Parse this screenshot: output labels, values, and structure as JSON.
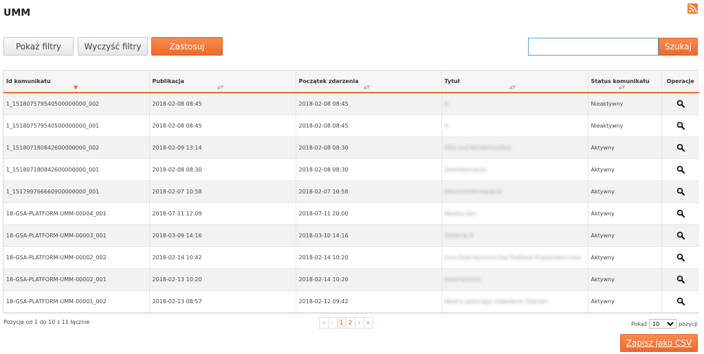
{
  "header": {
    "title": "UMM"
  },
  "toolbar": {
    "show_filters": "Pokaż filtry",
    "clear_filters": "Wyczyść filtry",
    "apply": "Zastosuj"
  },
  "search": {
    "value": "",
    "button": "Szukaj"
  },
  "table": {
    "columns": [
      "Id komunikatu",
      "Publikacja",
      "Początek zdarzenia",
      "Tytuł",
      "Status komunikatu",
      "Operacje"
    ],
    "rows": [
      {
        "id": "1_151807579540500000000_002",
        "published": "2018-02-08 08:45",
        "start": "2018-02-08 08:45",
        "title": "A",
        "status": "Nieaktywny"
      },
      {
        "id": "1_151807579540500000000_001",
        "published": "2018-02-08 08:45",
        "start": "2018-02-08 08:45",
        "title": "A",
        "status": "Nieaktywny"
      },
      {
        "id": "1_151807180842600000000_002",
        "published": "2018-02-09 13:14",
        "start": "2018-02-08 08:30",
        "title": "DEA und Nordatmosfera",
        "status": "Aktywny"
      },
      {
        "id": "1_151807180842600000000_001",
        "published": "2018-02-08 08:30",
        "start": "2018-02-08 08:30",
        "title": "Zawiadomienie",
        "status": "Aktywny"
      },
      {
        "id": "1_151799766660900000000_001",
        "published": "2018-02-07 10:58",
        "start": "2018-02-07 10:58",
        "title": "Ekonominformacje N",
        "status": "Aktywny"
      },
      {
        "id": "18-GSA-PLATFORM-UMM-00004_001",
        "published": "2018-07-11 12:09",
        "start": "2018-07-11 20:00",
        "title": "Awaria sieci",
        "status": "Aktywny"
      },
      {
        "id": "18-GSA-PLATFORM-UMM-00003_001",
        "published": "2018-03-09 14:16",
        "start": "2018-03-10 14:16",
        "title": "Ostatnie A",
        "status": "Aktywny"
      },
      {
        "id": "18-GSA-PLATFORM-UMM-00002_002",
        "published": "2018-02-14 10:42",
        "start": "2018-02-14 10:20",
        "title": "Inne Dział Kontrola Gaz Podlasie Przedsiebiorstwo",
        "status": "Aktywny"
      },
      {
        "id": "18-GSA-PLATFORM-UMM-00002_001",
        "published": "2018-02-13 10:20",
        "start": "2018-02-14 10:20",
        "title": "Dział kontroli",
        "status": "Aktywny"
      },
      {
        "id": "18-GSA-PLATFORM-UMM-00001_002",
        "published": "2018-02-13 08:57",
        "start": "2018-02-12 09:42",
        "title": "Awaria gazociągu Odwołanie Zdarzeń",
        "status": "Aktywny"
      }
    ]
  },
  "footer": {
    "info": "Pozycje od 1 do 10 z 11 łącznie",
    "pagination": {
      "first": "«",
      "prev": "‹",
      "pages": [
        "1",
        "2"
      ],
      "next": "›",
      "last": "»"
    },
    "page_size_label": "Pokaż",
    "page_size_value": "10",
    "page_size_suffix": "pozycji",
    "csv": "Zapisz jako CSV"
  },
  "icons": {
    "rss": "rss-icon",
    "view": "magnifier-icon"
  },
  "colors": {
    "accent": "#ee6a2b",
    "focus": "#5b9bd5"
  }
}
